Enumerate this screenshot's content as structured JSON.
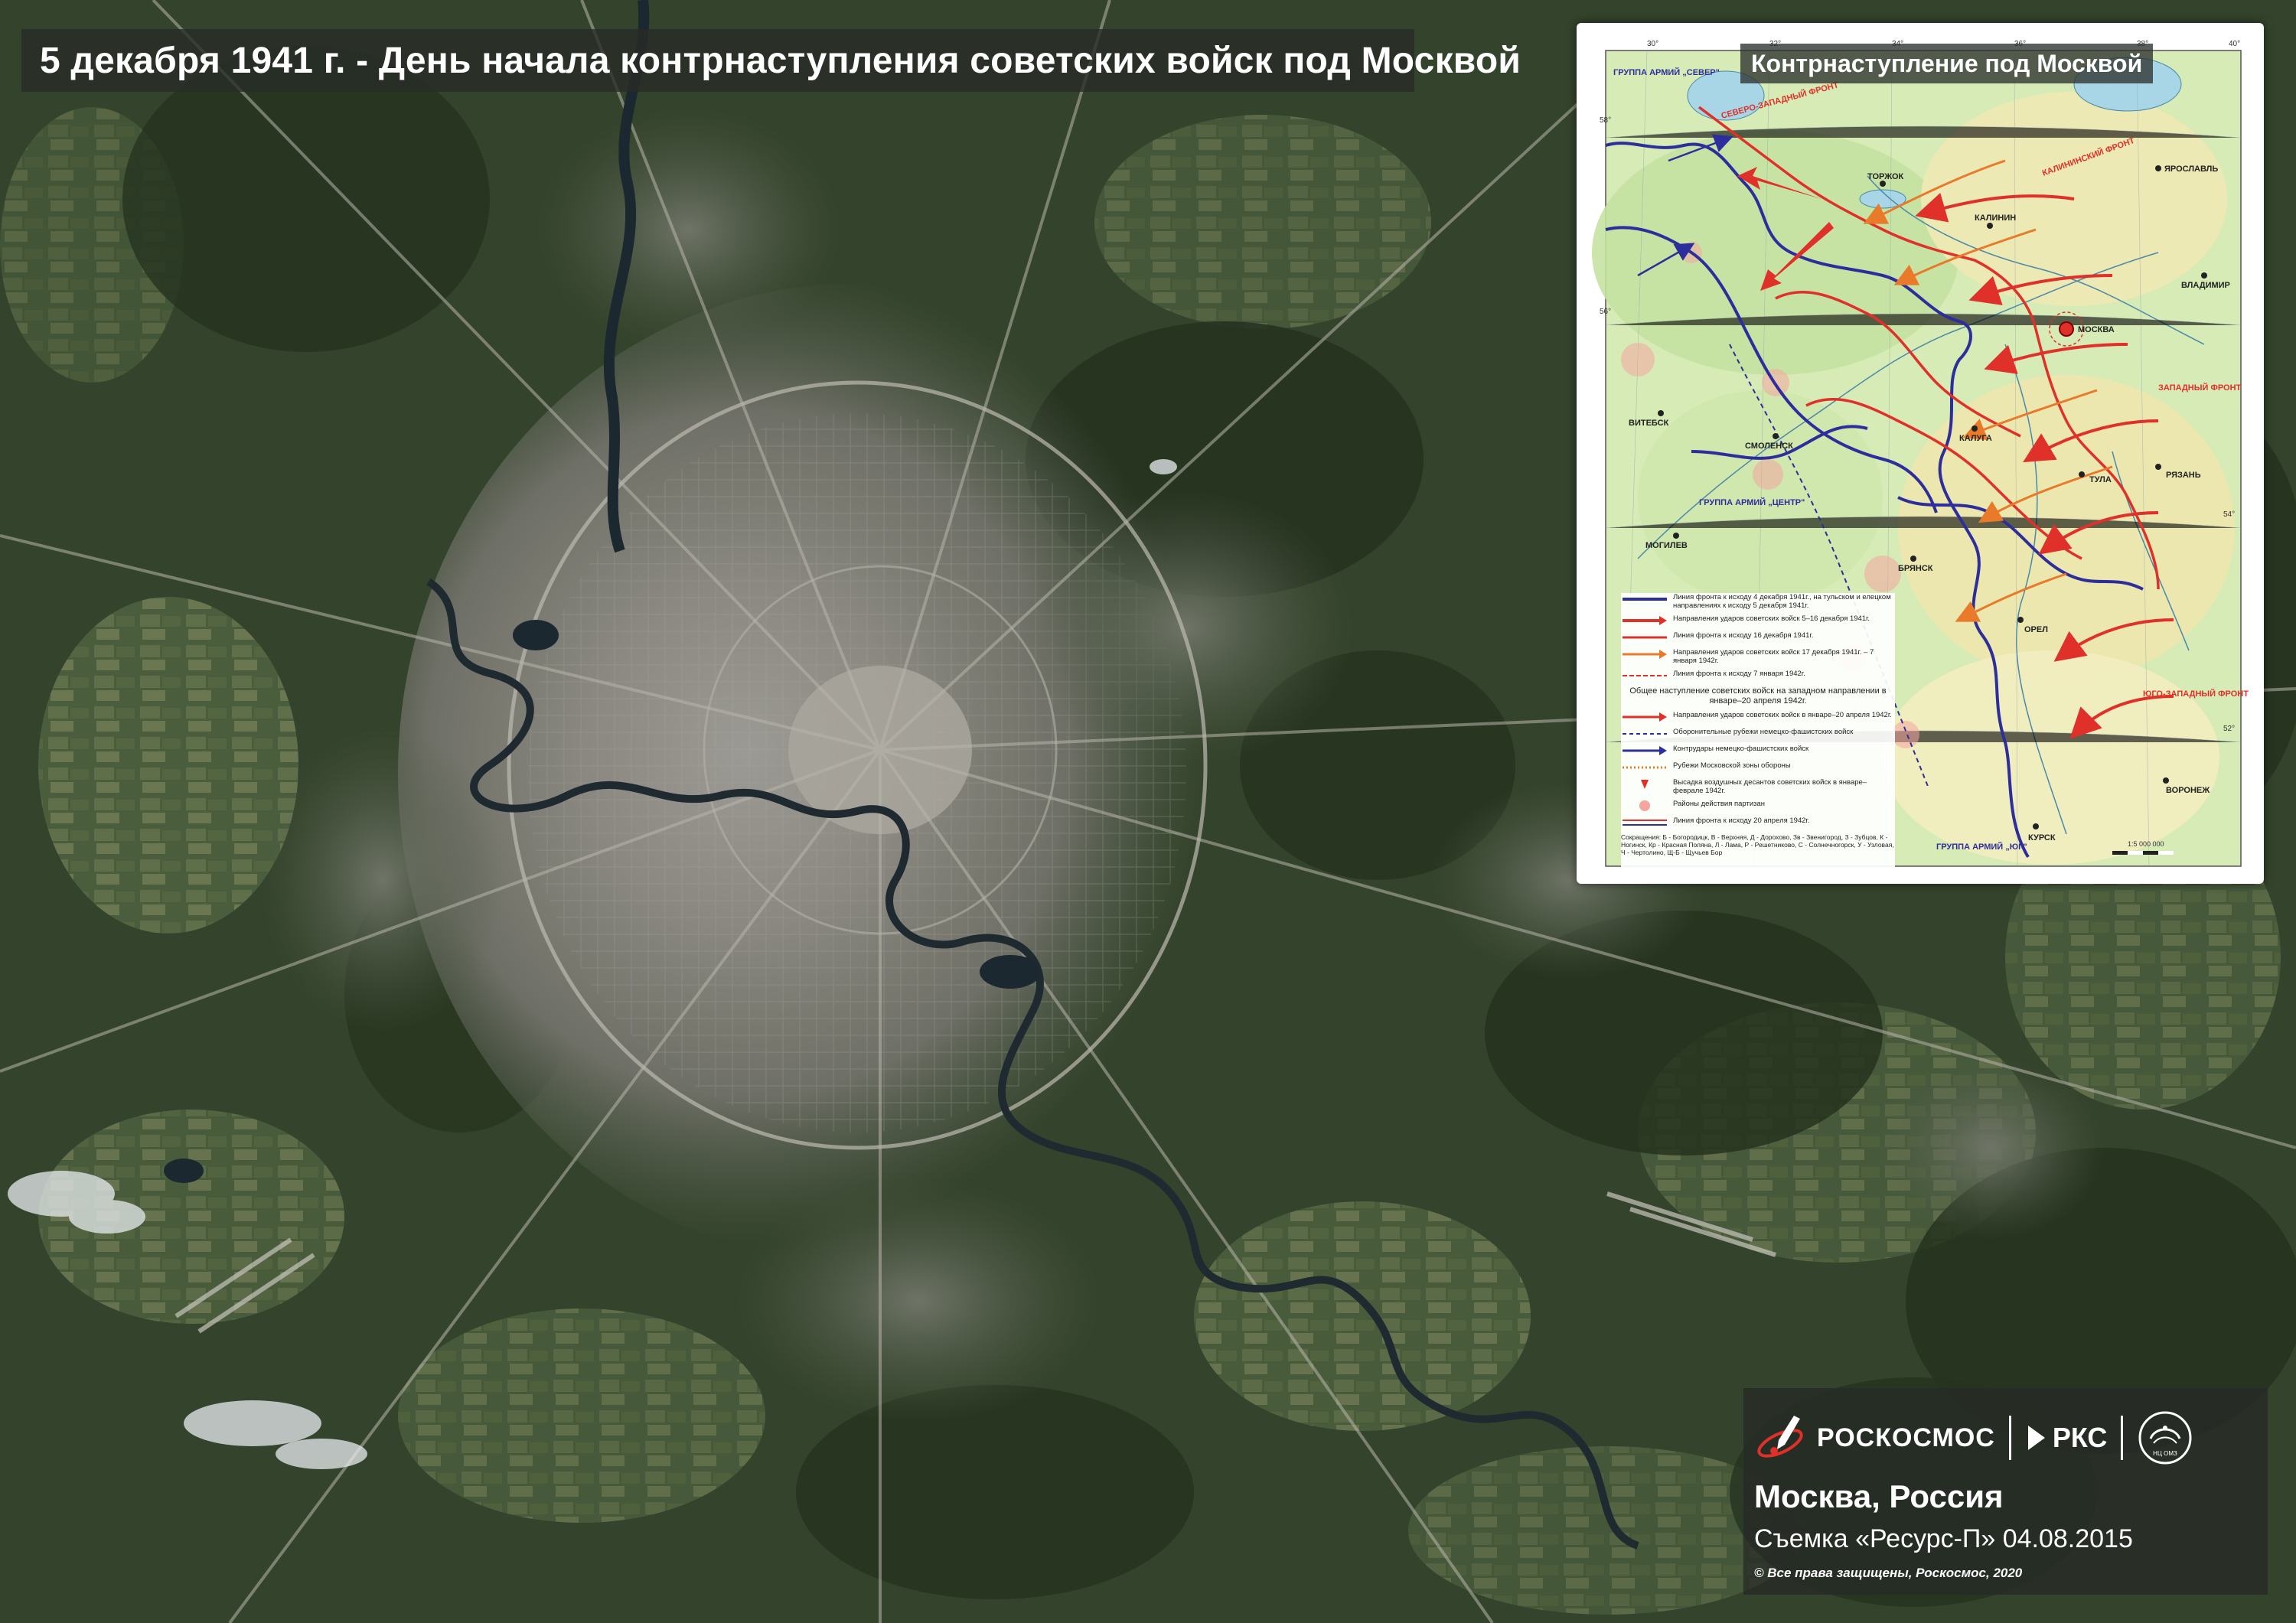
{
  "header": {
    "title": "5 декабря 1941 г. - День начала контрнаступления советских войск под Москвой"
  },
  "inset_map": {
    "title": "Контрнаступление под Москвой",
    "legend": [
      "Линия фронта к исходу 4 декабря 1941г., на тульском и елецком направлениях к исходу 5 декабря 1941г.",
      "Направления ударов советских войск 5–16 декабря 1941г.",
      "Линия фронта к исходу 16 декабря 1941г.",
      "Направления ударов советских войск 17 декабря 1941г. – 7 января 1942г.",
      "Линия фронта к исходу 7 января 1942г."
    ],
    "legend_center": "Общее наступление советских войск на западном направлении в январе–20 апреля 1942г.",
    "legend_more": [
      "Направления ударов советских войск в январе–20 апреля 1942г.",
      "Оборонительные рубежи немецко-фашистских войск",
      "Контрудары немецко-фашистских войск",
      "Рубежи Московской зоны обороны",
      "Высадка воздушных десантов советских войск в январе–феврале 1942г.",
      "Районы действия партизан",
      "Линия фронта к исходу 20 апреля 1942г."
    ],
    "abbreviations": "Сокращения: Б - Богородицк, В - Верхняя, Д - Дорохово, Зв - Звенигород, З - Зубцов, К - Ногинск, Кр - Красная Поляна, Л - Лама, Р - Решетниково, С - Солнечногорск, У - Узловая, Ч - Чертолино, Щ-Б - Щучьев Бор",
    "scale": "1:5 000 000",
    "army_groups": [
      "ГРУППА АРМИЙ „СЕВЕР\"",
      "ГРУППА АРМИЙ „ЦЕНТР\"",
      "ГРУППА АРМИЙ „ЮГ\""
    ],
    "fronts": [
      "СЕВЕРО-ЗАПАДНЫЙ ФРОНТ",
      "КАЛИНИНСКИЙ ФРОНТ",
      "ЗАПАДНЫЙ ФРОНТ",
      "ЮГО-ЗАПАДНЫЙ ФРОНТ"
    ],
    "cities": [
      "МОСКВА",
      "ЯРОСЛАВЛЬ",
      "СМОЛЕНСК",
      "ВИТЕБСК",
      "КУРСК",
      "МОГИЛЕВ",
      "РЯЗАНЬ",
      "ВЛАДИМИР",
      "КАЛИНИН",
      "ТУЛА",
      "ОРЕЛ",
      "ВОРОНЕЖ",
      "БРЯНСК",
      "КАЛУГА",
      "ТОРЖОК"
    ],
    "lat_labels": [
      "58°",
      "56°",
      "54°",
      "52°"
    ],
    "lon_labels": [
      "30°",
      "32°",
      "34°",
      "36°",
      "38°",
      "40°"
    ]
  },
  "branding": {
    "logo_name": "РОСКОСМОС",
    "logo_rks": "РКС",
    "logo_ntsoz": "НЦ ОМЗ",
    "place": "Москва, Россия",
    "survey": "Съемка «Ресурс-П» 04.08.2015",
    "copyright": "© Все права защищены, Роскосмос, 2020"
  },
  "icons": {
    "roscosmos": "rocket-orbit-icon",
    "rks": "rks-flag-icon",
    "ntsoz": "satellite-dish-emblem-icon"
  },
  "colors": {
    "soviet_red": "#e0302a",
    "german_blue": "#2d2e9c",
    "map_green": "#d6ebb5",
    "forest": "#2e3d26",
    "urban": "#7f7f78"
  }
}
